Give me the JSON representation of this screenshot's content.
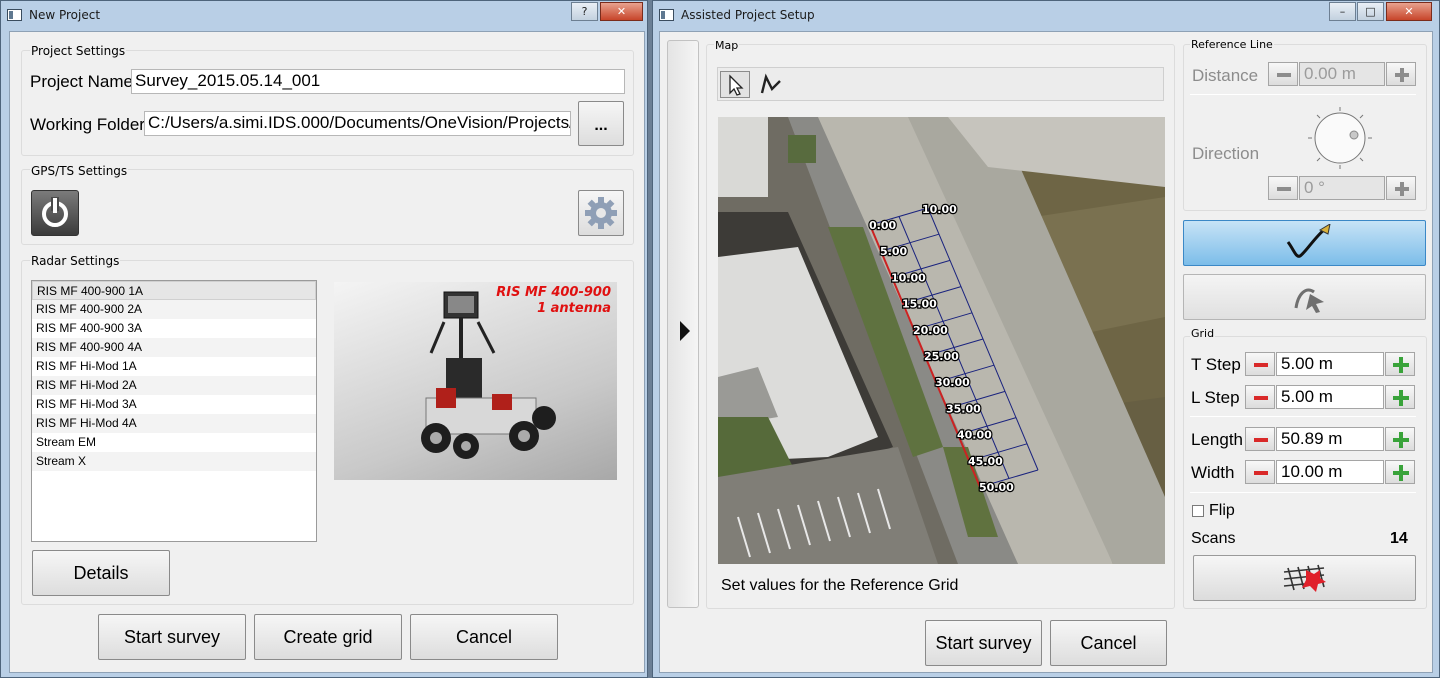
{
  "new_project": {
    "title": "New Project",
    "help_button": "?",
    "close_button": "✕",
    "project_settings": {
      "label": "Project Settings",
      "project_name_label": "Project Name",
      "project_name_value": "Survey_2015.05.14_001",
      "working_folder_label": "Working Folder",
      "working_folder_value": "C:/Users/a.simi.IDS.000/Documents/OneVision/Projects/",
      "browse_button": "..."
    },
    "gps_settings": {
      "label": "GPS/TS Settings",
      "power_icon": "power-icon",
      "settings_icon": "gear-icon"
    },
    "radar_settings": {
      "label": "Radar Settings",
      "items": [
        "RIS MF 400-900 1A",
        "RIS MF 400-900 2A",
        "RIS MF 400-900 3A",
        "RIS MF 400-900 4A",
        "RIS MF Hi-Mod 1A",
        "RIS MF Hi-Mod 2A",
        "RIS MF Hi-Mod 3A",
        "RIS MF Hi-Mod 4A",
        "Stream EM",
        "Stream X"
      ],
      "selected_index": 0,
      "preview_title": "RIS MF 400-900",
      "preview_subtitle": "1 antenna",
      "details_button": "Details"
    },
    "buttons": {
      "start_survey": "Start survey",
      "create_grid": "Create grid",
      "cancel": "Cancel"
    }
  },
  "assisted_setup": {
    "title": "Assisted Project Setup",
    "window_buttons": {
      "minimize": "–",
      "maximize": "□",
      "close": "✕"
    },
    "map": {
      "label": "Map",
      "tools": [
        "select-arrow-icon",
        "polyline-tool-icon"
      ],
      "grid_labels_left": [
        "0.00",
        "5.00",
        "10.00",
        "15.00",
        "20.00",
        "25.00",
        "30.00",
        "35.00",
        "40.00",
        "45.00",
        "50.00"
      ],
      "grid_label_top": "10.00",
      "status_text": "Set values for the Reference Grid"
    },
    "reference_line": {
      "label": "Reference Line",
      "distance_label": "Distance",
      "distance_value": "0.00 m",
      "direction_label": "Direction",
      "direction_value": "0 °"
    },
    "tools": {
      "edit_icon": "pen-line-icon",
      "cursor_icon": "pen-cursor-icon"
    },
    "grid": {
      "label": "Grid",
      "t_step_label": "T Step",
      "t_step_value": "5.00 m",
      "l_step_label": "L Step",
      "l_step_value": "5.00 m",
      "length_label": "Length",
      "length_value": "50.89 m",
      "width_label": "Width",
      "width_value": "10.00 m",
      "flip_label": "Flip",
      "flip_checked": false,
      "scans_label": "Scans",
      "scans_value": "14",
      "grid_button_icon": "grid-delete-icon"
    },
    "side_toggle_icon": "expand-arrow-icon",
    "buttons": {
      "start_survey": "Start survey",
      "cancel": "Cancel"
    }
  },
  "colors": {
    "accent_blue": "#7cbde9",
    "red_minus": "#d92929",
    "green_plus": "#39a33a",
    "grid_line": "#1a237e",
    "reference_line": "#cc2222"
  }
}
